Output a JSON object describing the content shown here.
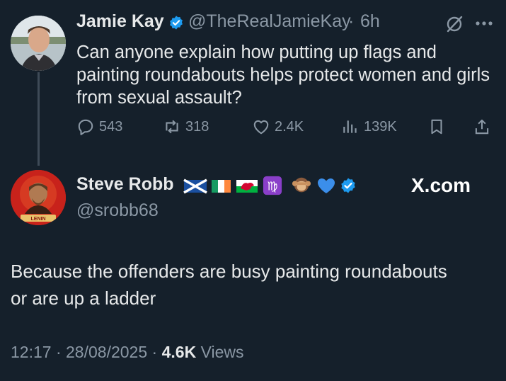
{
  "tweet": {
    "author_name": "Jamie Kay",
    "handle": "@TheRealJamieKay",
    "time": "6h",
    "text": "Can anyone explain how putting up flags and painting roundabouts helps protect women and girls from sexual assault?",
    "replies": "543",
    "reposts": "318",
    "likes": "2.4K",
    "views": "139K"
  },
  "reply": {
    "author_name": "Steve Robb",
    "handle": "@srobb68",
    "avatar_text": "LENIN",
    "text": "Because the offenders are busy painting roundabouts or are up a ladder",
    "time": "12:17",
    "date": "28/08/2025",
    "views_count": "4.6K",
    "views_label": "Views"
  },
  "watermark": "X.com",
  "colors": {
    "background": "#15202b",
    "text": "#e7e9ea",
    "muted": "#8b98a5",
    "verified": "#1d9bf0"
  },
  "icons": [
    "verified-icon",
    "grok-icon",
    "more-icon",
    "reply-icon",
    "repost-icon",
    "like-icon",
    "views-icon",
    "bookmark-icon",
    "share-icon"
  ]
}
